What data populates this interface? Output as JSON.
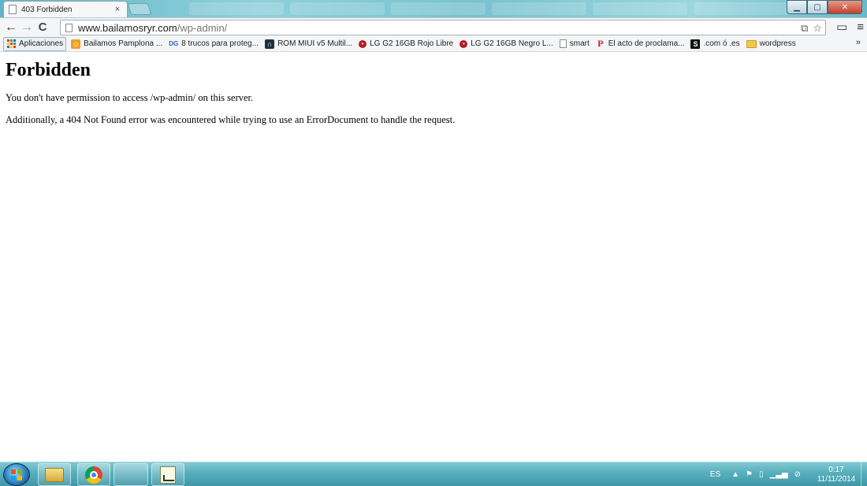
{
  "window": {
    "tab_title": "403 Forbidden",
    "tab_close": "×",
    "controls": {
      "minimize": "▁",
      "maximize": "▢",
      "close": "✕"
    }
  },
  "toolbar": {
    "back": "←",
    "forward": "→",
    "reload": "C",
    "url_host": "www.bailamosryr.com",
    "url_path": "/wp-admin/",
    "translate_icon": "⧉",
    "star_icon": "☆",
    "cast_icon": "▭",
    "menu_icon": "≡"
  },
  "bookmarks": [
    {
      "label": "Aplicaciones",
      "icon": "apps-grid-icon"
    },
    {
      "label": "Bailamos Pamplona ...",
      "icon": "bailamos-icon"
    },
    {
      "label": "8 trucos para proteg...",
      "icon": "dg-icon"
    },
    {
      "label": "ROM MIUI v5 Multil...",
      "icon": "rom-icon"
    },
    {
      "label": "LG G2 16GB Rojo Libre",
      "icon": "lg-icon"
    },
    {
      "label": "LG G2 16GB Negro L...",
      "icon": "lg-icon"
    },
    {
      "label": "smart",
      "icon": "page-icon"
    },
    {
      "label": "El acto de proclama...",
      "icon": "p-icon"
    },
    {
      "label": ".com ó .es",
      "icon": "s-icon"
    },
    {
      "label": "wordpress",
      "icon": "folder-icon"
    }
  ],
  "bookmarks_more": "»",
  "page": {
    "heading": "Forbidden",
    "paragraph_1": "You don't have permission to access /wp-admin/ on this server.",
    "paragraph_2": "Additionally, a 404 Not Found error was encountered while trying to use an ErrorDocument to handle the request."
  },
  "taskbar": {
    "language": "ES",
    "tray_arrow": "▲",
    "time": "0:17",
    "date": "11/11/2014"
  }
}
